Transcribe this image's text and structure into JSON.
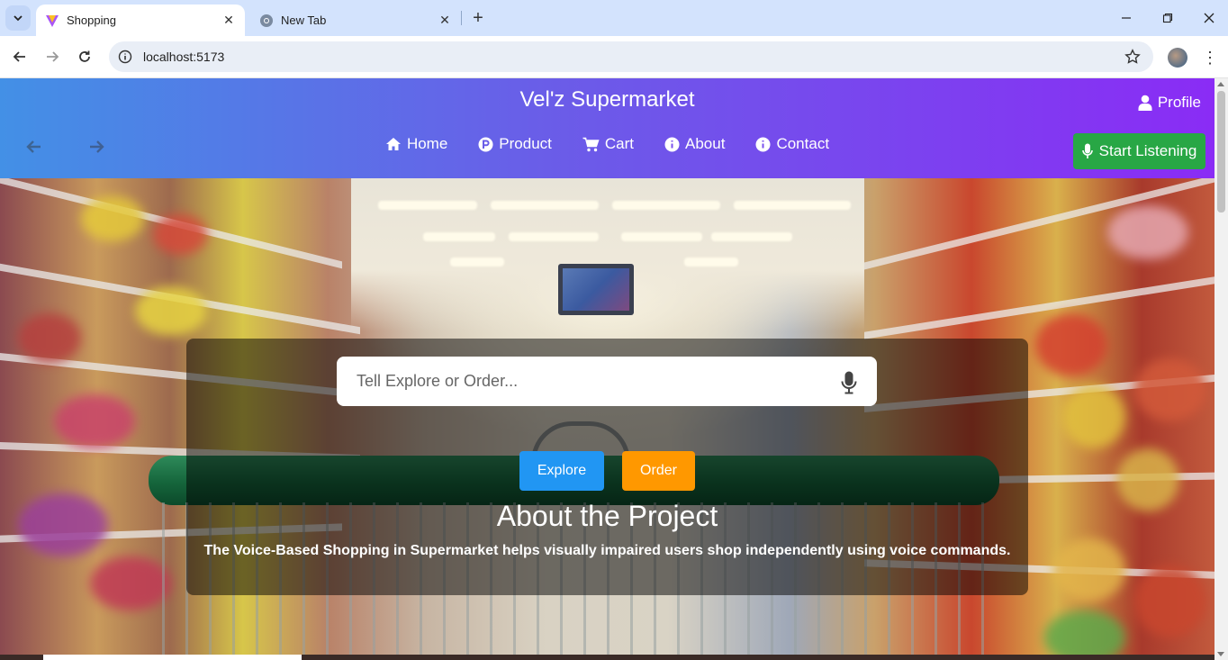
{
  "browser": {
    "tabs": [
      {
        "title": "Shopping",
        "active": true,
        "favicon": "vite-logo-icon"
      },
      {
        "title": "New Tab",
        "active": false,
        "favicon": "chrome-logo-icon"
      }
    ],
    "url": "localhost:5173"
  },
  "header": {
    "title": "Vel'z Supermarket",
    "profile_label": "Profile",
    "nav": [
      {
        "label": "Home",
        "icon": "home-icon"
      },
      {
        "label": "Product",
        "icon": "product-p-icon"
      },
      {
        "label": "Cart",
        "icon": "cart-icon"
      },
      {
        "label": "About",
        "icon": "info-icon"
      },
      {
        "label": "Contact",
        "icon": "info-icon"
      }
    ],
    "listen_label": "Start Listening"
  },
  "hero": {
    "search_placeholder": "Tell Explore or Order...",
    "explore_label": "Explore",
    "order_label": "Order",
    "about_title": "About the Project",
    "about_text": "The Voice-Based Shopping in Supermarket helps visually impaired users shop independently using voice commands."
  },
  "colors": {
    "header_gradient_start": "#4390e6",
    "header_gradient_end": "#8a2cf5",
    "listen_button": "#28a745",
    "explore_button": "#2196f3",
    "order_button": "#ff9800"
  }
}
